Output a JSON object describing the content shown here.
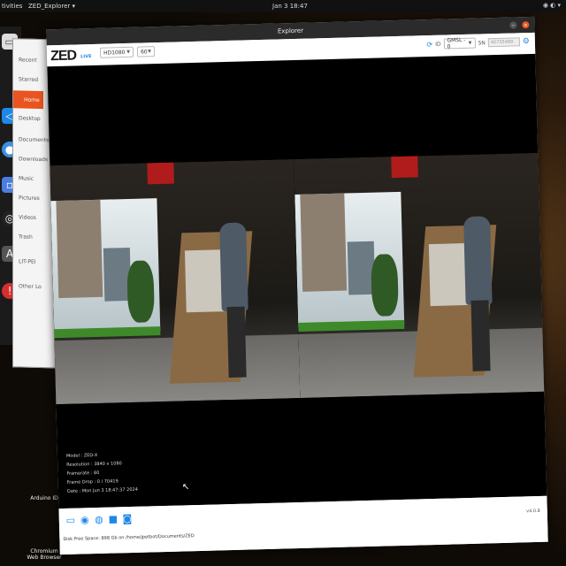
{
  "topbar": {
    "activities": "tivities",
    "app_menu": "ZED_Explorer ▾",
    "clock": "Jan 3  18:47"
  },
  "dock": {
    "items": [
      "files-icon",
      "vscode-icon",
      "chromium-icon",
      "remote-icon",
      "obs-icon",
      "software-icon",
      "error-icon"
    ]
  },
  "desktop": {
    "labels": [
      "Arduino ID",
      "Chromium Web Browser"
    ]
  },
  "files": {
    "items": [
      "Recent",
      "Starred",
      "Home",
      "Desktop",
      "Documents",
      "Downloads",
      "Music",
      "Pictures",
      "Videos",
      "Trash",
      "LIT-PEI",
      "Other Lo"
    ],
    "active": "Home"
  },
  "window": {
    "title": "Explorer"
  },
  "toolbar": {
    "logo": "ZED",
    "logo_sub": "LIVE",
    "resolution": "HD1080",
    "fps": "60",
    "id_label": "ID",
    "camera_select": "GMSL - 0",
    "sn_label": "SN",
    "sn_placeholder": "40735488"
  },
  "info": {
    "model": "Model : ZED-X",
    "resolution": "Resolution : 3840 x 1080",
    "framerate": "Framerate : 60",
    "frame_drop": "Frame Drop : 0 / 70419",
    "date": "Date : Mon Jun 3 18:47:37 2024"
  },
  "statusbar": {
    "version": "v4.0.8",
    "disk": "Disk Free Space: 898 Gb  on /home/jpetbot/Documents/ZED"
  }
}
